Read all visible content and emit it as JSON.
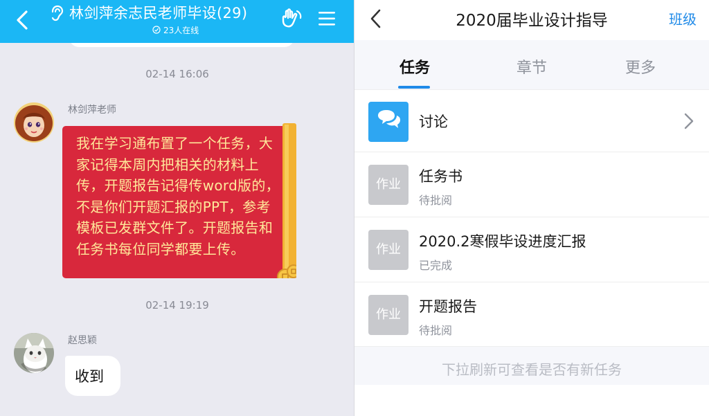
{
  "chat": {
    "title": "林剑萍余志民老师毕设(29)",
    "online": "23人在线",
    "messages": [
      {
        "timestamp": "02-14 16:06",
        "sender": "林剑萍老师",
        "text": "我在学习通布置了一个任务，大家记得本周内把相关的材料上传，开题报告记得传word版的，不是你们开题汇报的PPT，参考模板已发群文件了。开题报告和任务书每位同学都要上传。"
      },
      {
        "timestamp": "02-14 19:19",
        "sender": "赵思颖",
        "text": "收到"
      }
    ]
  },
  "course": {
    "title": "2020届毕业设计指导",
    "class_link": "班级",
    "tabs": [
      {
        "label": "任务",
        "active": true
      },
      {
        "label": "章节",
        "active": false
      },
      {
        "label": "更多",
        "active": false
      }
    ],
    "discussion": {
      "label": "讨论"
    },
    "assignments": [
      {
        "badge": "作业",
        "title": "任务书",
        "status": "待批阅"
      },
      {
        "badge": "作业",
        "title": "2020.2寒假毕设进度汇报",
        "status": "已完成"
      },
      {
        "badge": "作业",
        "title": "开题报告",
        "status": "待批阅"
      }
    ],
    "refresh_hint": "下拉刷新可查看是否有新任务"
  },
  "colors": {
    "chat_header": "#1bb7f5",
    "accent_blue": "#1f8ae8",
    "red_packet": "#d8283c",
    "red_packet_text": "#ffe89a",
    "homework_badge": "#c8c9cd",
    "discussion_badge": "#2ea6f2"
  },
  "icons": [
    "back-arrow-icon",
    "ear-icon",
    "clock-icon",
    "hand-gesture-icon",
    "menu-icon",
    "chat-bubbles-icon",
    "chevron-right-icon"
  ]
}
